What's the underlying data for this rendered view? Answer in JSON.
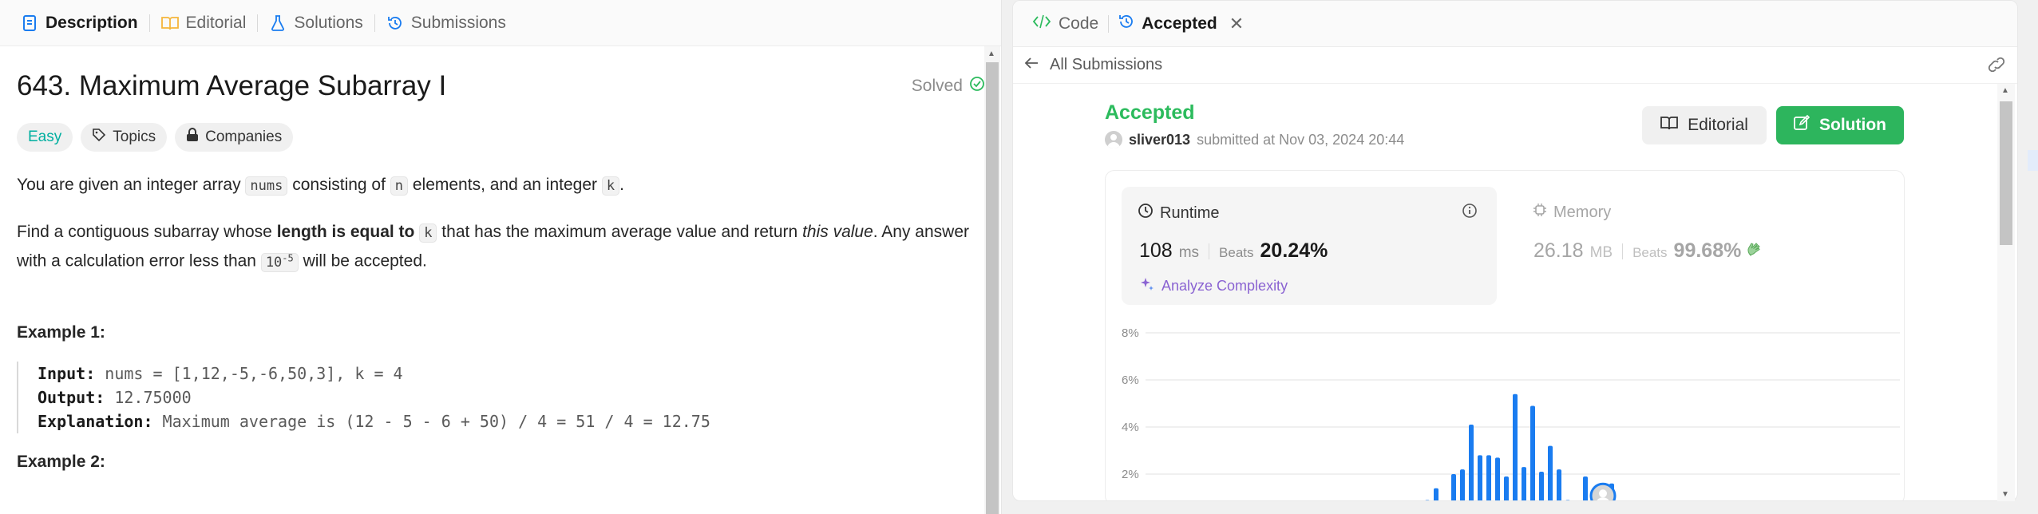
{
  "left": {
    "tabs": [
      {
        "label": "Description",
        "icon": "description-icon"
      },
      {
        "label": "Editorial",
        "icon": "book-icon"
      },
      {
        "label": "Solutions",
        "icon": "flask-icon"
      },
      {
        "label": "Submissions",
        "icon": "history-icon"
      }
    ],
    "problem": {
      "title": "643. Maximum Average Subarray I",
      "solved_label": "Solved",
      "difficulty": "Easy",
      "topics_label": "Topics",
      "companies_label": "Companies",
      "p1": {
        "a": "You are given an integer array ",
        "code1": "nums",
        "b": " consisting of ",
        "code2": "n",
        "c": " elements, and an integer ",
        "code3": "k",
        "d": "."
      },
      "p2": {
        "a": "Find a contiguous subarray whose ",
        "bold": "length is equal to",
        "code1": "k",
        "b": " that has the maximum average value and return ",
        "ital": "this value",
        "c": ". Any answer with a calculation error less than ",
        "code_base": "10",
        "code_exp": "-5",
        "d": " will be accepted."
      },
      "example1": {
        "title": "Example 1:",
        "input_label": "Input:",
        "input": "nums = [1,12,-5,-6,50,3], k = 4",
        "output_label": "Output:",
        "output": "12.75000",
        "expl_label": "Explanation:",
        "explanation": "Maximum average is (12 - 5 - 6 + 50) / 4 = 51 / 4 = 12.75"
      },
      "example2_title": "Example 2:"
    }
  },
  "right": {
    "tabs": [
      {
        "label": "Code",
        "icon": "code-icon"
      },
      {
        "label": "Accepted",
        "icon": "history-icon"
      }
    ],
    "back_label": "All Submissions",
    "status": "Accepted",
    "user": "sliver013",
    "submitted_text": "submitted at Nov 03, 2024 20:44",
    "editorial_btn": "Editorial",
    "solution_btn": "Solution",
    "runtime": {
      "label": "Runtime",
      "value": "108",
      "unit": "ms",
      "beats_label": "Beats",
      "beats": "20.24%",
      "analyze": "Analyze Complexity"
    },
    "memory": {
      "label": "Memory",
      "value": "26.18",
      "unit": "MB",
      "beats_label": "Beats",
      "beats": "99.68%"
    }
  },
  "colors": {
    "accepted": "#2cbb5d",
    "bar": "#1a7cf0",
    "easy": "#00afa0",
    "analyze": "#8a63d2"
  },
  "chart_data": {
    "type": "bar",
    "ylim": [
      0,
      8
    ],
    "yticks": [
      "8%",
      "6%",
      "4%",
      "2%"
    ],
    "ytick_values": [
      8,
      6,
      4,
      2
    ],
    "values": [
      0.2,
      0,
      0.15,
      0,
      0.25,
      0.2,
      0.2,
      0,
      0.2,
      0,
      0.15,
      0.25,
      0,
      0,
      0.3,
      0,
      0,
      0.3,
      0,
      0,
      0.9,
      1.4,
      0.8,
      2.0,
      2.2,
      4.1,
      2.8,
      2.8,
      2.7,
      1.9,
      5.4,
      2.3,
      4.9,
      2.1,
      3.2,
      2.2,
      0.9,
      0.6,
      1.9,
      0.2,
      0.6,
      1.6,
      0.7,
      0.6,
      0.3,
      0.2,
      0.3,
      0,
      0,
      0.4,
      0,
      0.2,
      0,
      0.1
    ],
    "highlight_index": 40
  }
}
